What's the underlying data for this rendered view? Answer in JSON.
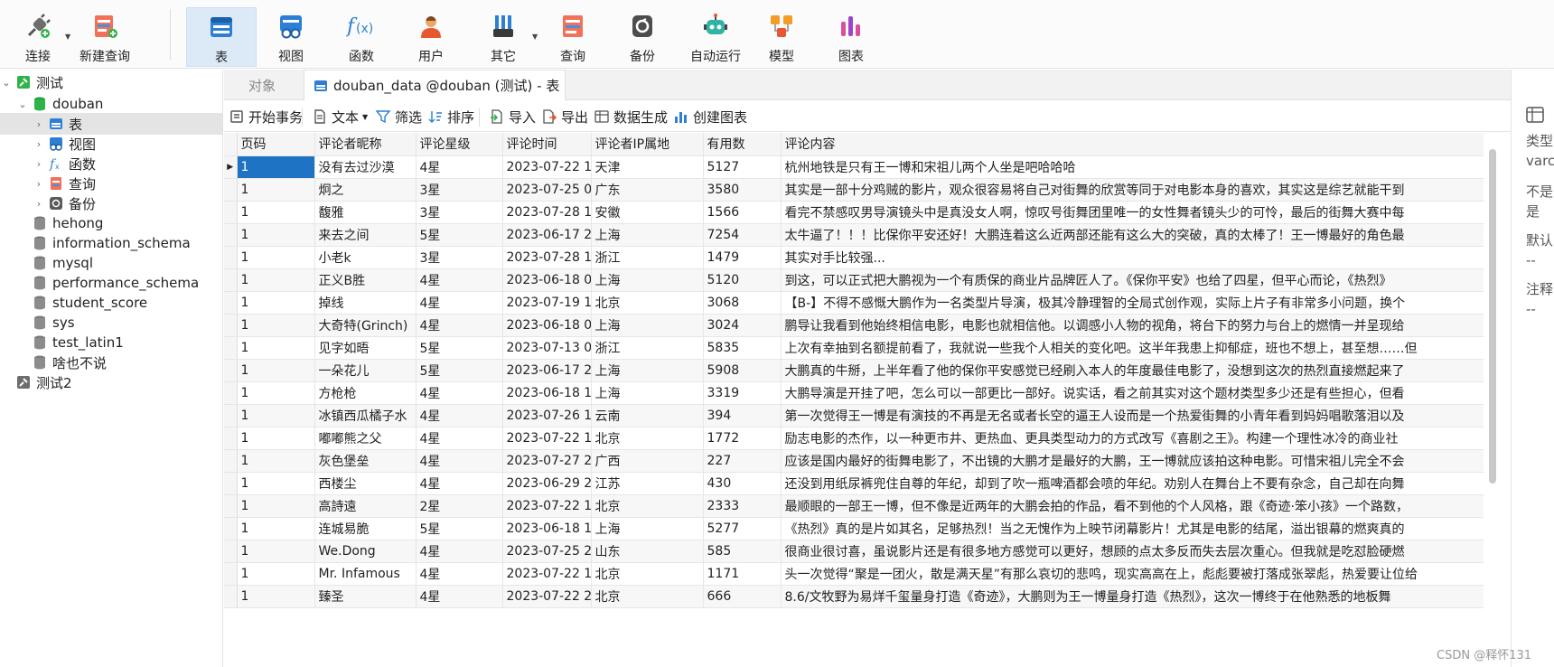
{
  "toolbar": {
    "items": [
      {
        "label": "连接",
        "icon": "plug-icon"
      },
      {
        "label": "新建查询",
        "icon": "new-query-icon"
      },
      {
        "label": "表",
        "icon": "table-icon"
      },
      {
        "label": "视图",
        "icon": "view-icon"
      },
      {
        "label": "函数",
        "icon": "function-icon"
      },
      {
        "label": "用户",
        "icon": "user-icon"
      },
      {
        "label": "其它",
        "icon": "tools-icon"
      },
      {
        "label": "查询",
        "icon": "query-icon"
      },
      {
        "label": "备份",
        "icon": "backup-icon"
      },
      {
        "label": "自动运行",
        "icon": "robot-icon"
      },
      {
        "label": "模型",
        "icon": "model-icon"
      },
      {
        "label": "图表",
        "icon": "chart-icon"
      }
    ],
    "active": "表"
  },
  "tree": {
    "connection1": "测试",
    "db_open": "douban",
    "children": [
      "表",
      "视图",
      "函数",
      "查询",
      "备份"
    ],
    "databases": [
      "hehong",
      "information_schema",
      "mysql",
      "performance_schema",
      "student_score",
      "sys",
      "test_latin1",
      "啥也不说"
    ],
    "connection2": "测试2"
  },
  "tabs": {
    "objects": "对象",
    "active_tab": "douban_data @douban (测试) - 表"
  },
  "subbar": {
    "begin_tx": "开始事务",
    "text": "文本",
    "filter": "筛选",
    "sort": "排序",
    "import": "导入",
    "export": "导出",
    "datagen": "数据生成",
    "create_chart": "创建图表"
  },
  "grid": {
    "columns": [
      "页码",
      "评论者昵称",
      "评论星级",
      "评论时间",
      "评论者IP属地",
      "有用数",
      "评论内容"
    ],
    "rows": [
      [
        "1",
        "没有去过沙漠",
        "4星",
        "2023-07-22 1",
        "天津",
        "5127",
        "杭州地铁是只有王一博和宋祖儿两个人坐是吧哈哈哈"
      ],
      [
        "1",
        "炯之",
        "3星",
        "2023-07-25 0",
        "广东",
        "3580",
        "其实是一部十分鸡贼的影片，观众很容易将自己对街舞的欣赏等同于对电影本身的喜欢，其实这是综艺就能干到"
      ],
      [
        "1",
        "馥雅",
        "3星",
        "2023-07-28 1",
        "安徽",
        "1566",
        "看完不禁感叹男导演镜头中是真没女人啊，惊叹号街舞团里唯一的女性舞者镜头少的可怜，最后的街舞大赛中每"
      ],
      [
        "1",
        "来去之间",
        "5星",
        "2023-06-17 2",
        "上海",
        "7254",
        "太牛逼了！！！比保你平安还好！大鹏连着这么近两部还能有这么大的突破，真的太棒了！王一博最好的角色最"
      ],
      [
        "1",
        "小老k",
        "3星",
        "2023-07-28 1",
        "浙江",
        "1479",
        "其实对手比较强..."
      ],
      [
        "1",
        "正义B胜",
        "4星",
        "2023-06-18 0",
        "上海",
        "5120",
        "到这，可以正式把大鹏视为一个有质保的商业片品牌匠人了。《保你平安》也给了四星，但平心而论，《热烈》"
      ],
      [
        "1",
        "掉线",
        "4星",
        "2023-07-19 1",
        "北京",
        "3068",
        "【B-】不得不感慨大鹏作为一名类型片导演，极其冷静理智的全局式创作观，实际上片子有非常多小问题，换个"
      ],
      [
        "1",
        "大奇特(Grinch)",
        "4星",
        "2023-06-18 0",
        "上海",
        "3024",
        "鹏导让我看到他始终相信电影，电影也就相信他。以调感小人物的视角，将台下的努力与台上的燃情一并呈现给"
      ],
      [
        "1",
        "见字如晤",
        "5星",
        "2023-07-13 0",
        "浙江",
        "5835",
        "上次有幸抽到名额提前看了，我就说一些我个人相关的变化吧。这半年我患上抑郁症，班也不想上，甚至想……但"
      ],
      [
        "1",
        "一朵花儿",
        "5星",
        "2023-06-17 2",
        "上海",
        "5908",
        "大鹏真的牛掰，上半年看了他的保你平安感觉已经刷入本人的年度最佳电影了，没想到这次的热烈直接燃起来了"
      ],
      [
        "1",
        "方枪枪",
        "4星",
        "2023-06-18 1",
        "上海",
        "3319",
        "大鹏导演是开挂了吧，怎么可以一部更比一部好。说实话，看之前其实对这个题材类型多少还是有些担心，但看"
      ],
      [
        "1",
        "冰镇西瓜橘子水",
        "4星",
        "2023-07-26 1",
        "云南",
        "394",
        "第一次觉得王一博是有演技的不再是无名或者长空的逼王人设而是一个热爱街舞的小青年看到妈妈唱歌落泪以及"
      ],
      [
        "1",
        "嘟嘟熊之父",
        "4星",
        "2023-07-22 1",
        "北京",
        "1772",
        "励志电影的杰作，以一种更市井、更热血、更具类型动力的方式改写《喜剧之王》。构建一个理性冰冷的商业社"
      ],
      [
        "1",
        "灰色堡垒",
        "4星",
        "2023-07-27 2",
        "广西",
        "227",
        "应该是国内最好的街舞电影了，不出镜的大鹏才是最好的大鹏，王一博就应该拍这种电影。可惜宋祖儿完全不会"
      ],
      [
        "1",
        "西楼尘",
        "4星",
        "2023-06-29 2",
        "江苏",
        "430",
        "还没到用纸尿裤兜住自尊的年纪，却到了吹一瓶啤酒都会喷的年纪。劝别人在舞台上不要有杂念，自己却在向舞"
      ],
      [
        "1",
        "高詩遠",
        "2星",
        "2023-07-22 1",
        "北京",
        "2333",
        "最顺眼的一部王一博，但不像是近两年的大鹏会拍的作品，看不到他的个人风格，跟《奇迹·笨小孩》一个路数，"
      ],
      [
        "1",
        "连城易脆",
        "5星",
        "2023-06-18 1",
        "上海",
        "5277",
        "《热烈》真的是片如其名，足够热烈！当之无愧作为上映节闭幕影片！尤其是电影的结尾，溢出银幕的燃爽真的"
      ],
      [
        "1",
        "We.Dong",
        "4星",
        "2023-07-25 2",
        "山东",
        "585",
        "很商业很讨喜，虽说影片还是有很多地方感觉可以更好，想顾的点太多反而失去层次重心。但我就是吃怼脸硬燃"
      ],
      [
        "1",
        "Mr. Infamous",
        "4星",
        "2023-07-22 1",
        "北京",
        "1171",
        "头一次觉得“聚是一团火，散是满天星”有那么哀切的悲鸣，现实高高在上，彪彪要被打落成张翠彪，热爱要让位给"
      ],
      [
        "1",
        "臻圣",
        "4星",
        "2023-07-22 2",
        "北京",
        "666",
        "8.6/文牧野为易烊千玺量身打造《奇迹》，大鹏则为王一博量身打造《热烈》，这次一博终于在他熟悉的地板舞"
      ]
    ]
  },
  "rightpanel": {
    "lines": [
      "类型",
      "varc",
      "不是",
      "是",
      "默认",
      "--",
      "注释",
      "--"
    ]
  },
  "watermark": "CSDN @释怀131",
  "colors": {
    "accent": "#1e73c4",
    "active_tool": "#dceaf7",
    "selected_tree": "#e4e4e4"
  }
}
